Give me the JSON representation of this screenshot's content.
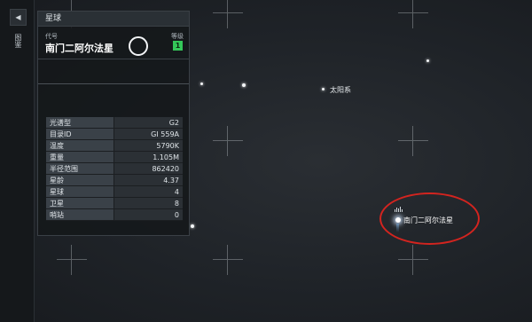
{
  "sidebar": {
    "back_icon": "◀",
    "tab_label": "图鉴"
  },
  "panel": {
    "header": "星球",
    "code_label": "代号",
    "level_label": "等级",
    "name": "南门二阿尔法星",
    "level": "1",
    "stats": [
      {
        "key": "光谱型",
        "value": "G2"
      },
      {
        "key": "目录ID",
        "value": "GI 559A"
      },
      {
        "key": "温度",
        "value": "5790K"
      },
      {
        "key": "重量",
        "value": "1.105M"
      },
      {
        "key": "半径范围",
        "value": "862420"
      },
      {
        "key": "星龄",
        "value": "4.37"
      },
      {
        "key": "星球",
        "value": "4"
      },
      {
        "key": "卫星",
        "value": "8"
      },
      {
        "key": "哨站",
        "value": "0"
      }
    ]
  },
  "map": {
    "sun_label": "太阳系",
    "target_label": "南门二阿尔法星"
  },
  "colors": {
    "annotation_red": "#d3241f",
    "level_green": "#34c759"
  }
}
